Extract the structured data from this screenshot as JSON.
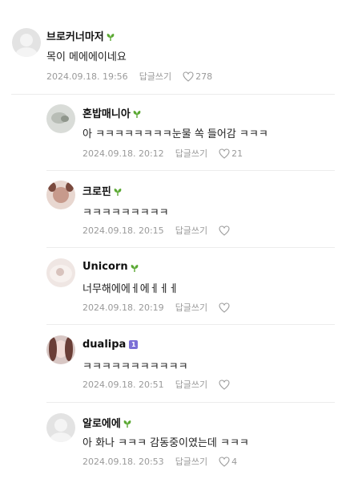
{
  "comments": [
    {
      "nickname": "브로커너마저",
      "badge": "leaf",
      "text": "목이 메에에이네요",
      "timestamp": "2024.09.18. 19:56",
      "reply_label": "답글쓰기",
      "like_count": "278"
    },
    {
      "nickname": "혼밥매니아",
      "badge": "leaf",
      "text": "아 ㅋㅋㅋㅋㅋㅋㅋㅋ눈물 쏙 들어감 ㅋㅋㅋ",
      "timestamp": "2024.09.18. 20:12",
      "reply_label": "답글쓰기",
      "like_count": "21"
    },
    {
      "nickname": "크로핀",
      "badge": "leaf",
      "text": "ㅋㅋㅋㅋㅋㅋㅋㅋㅋ",
      "timestamp": "2024.09.18. 20:15",
      "reply_label": "답글쓰기",
      "like_count": ""
    },
    {
      "nickname": "Unicorn",
      "badge": "leaf",
      "text": "너무해에에ㅔ에ㅔㅔㅔ",
      "timestamp": "2024.09.18. 20:19",
      "reply_label": "답글쓰기",
      "like_count": ""
    },
    {
      "nickname": "dualipa",
      "badge": "level",
      "badge_text": "1",
      "text": "ㅋㅋㅋㅋㅋㅋㅋㅋㅋㅋㅋ",
      "timestamp": "2024.09.18. 20:51",
      "reply_label": "답글쓰기",
      "like_count": ""
    },
    {
      "nickname": "알로에에",
      "badge": "leaf",
      "text": "아 화나 ㅋㅋㅋ 감동중이였는데 ㅋㅋㅋ",
      "timestamp": "2024.09.18. 20:53",
      "reply_label": "답글쓰기",
      "like_count": "4"
    }
  ],
  "colors": {
    "leaf": "#5aa832",
    "meta": "#9a9a9a",
    "badge": "#7b6fd6"
  }
}
